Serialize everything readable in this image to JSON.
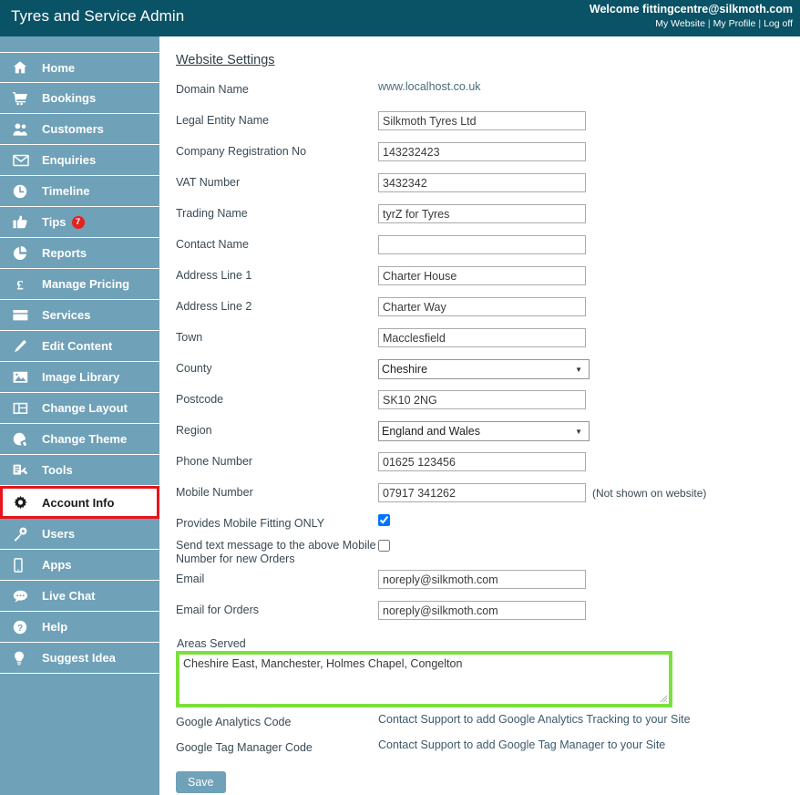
{
  "header": {
    "title": "Tyres and Service Admin",
    "welcome": "Welcome fittingcentre@silkmoth.com",
    "links": [
      {
        "label": "My Website"
      },
      {
        "label": "My Profile"
      },
      {
        "label": "Log off"
      }
    ],
    "separator": "|",
    "bg_color": "#0a5265"
  },
  "sidebar": {
    "bg_color": "#6fa1b8",
    "active_highlight_color": "#e8131a",
    "items": [
      {
        "label": "Home",
        "icon": "home-icon",
        "active": false
      },
      {
        "label": "Bookings",
        "icon": "cart-icon",
        "active": false
      },
      {
        "label": "Customers",
        "icon": "users-icon",
        "active": false
      },
      {
        "label": "Enquiries",
        "icon": "envelope-icon",
        "active": false
      },
      {
        "label": "Timeline",
        "icon": "clock-icon",
        "active": false
      },
      {
        "label": "Tips",
        "icon": "thumbs-up-icon",
        "active": false,
        "badge": "7"
      },
      {
        "label": "Reports",
        "icon": "pie-chart-icon",
        "active": false
      },
      {
        "label": "Manage Pricing",
        "icon": "pound-icon",
        "active": false
      },
      {
        "label": "Services",
        "icon": "card-icon",
        "active": false
      },
      {
        "label": "Edit Content",
        "icon": "pencil-icon",
        "active": false
      },
      {
        "label": "Image Library",
        "icon": "image-icon",
        "active": false
      },
      {
        "label": "Change Layout",
        "icon": "layout-icon",
        "active": false
      },
      {
        "label": "Change Theme",
        "icon": "paint-brush-icon",
        "active": false
      },
      {
        "label": "Tools",
        "icon": "tools-icon",
        "active": false
      },
      {
        "label": "Account Info",
        "icon": "gear-icon",
        "active": true
      },
      {
        "label": "Users",
        "icon": "key-icon",
        "active": false
      },
      {
        "label": "Apps",
        "icon": "mobile-icon",
        "active": false
      },
      {
        "label": "Live Chat",
        "icon": "chat-bubble-icon",
        "active": false
      },
      {
        "label": "Help",
        "icon": "question-mark-icon",
        "active": false
      },
      {
        "label": "Suggest Idea",
        "icon": "lightbulb-icon",
        "active": false
      }
    ]
  },
  "main": {
    "title": "Website Settings",
    "fields": {
      "domain_name": {
        "label": "Domain Name",
        "value": "www.localhost.co.uk",
        "type": "link"
      },
      "legal_entity_name": {
        "label": "Legal Entity Name",
        "value": "Silkmoth Tyres Ltd",
        "type": "text"
      },
      "company_registration_no": {
        "label": "Company Registration No",
        "value": "143232423",
        "type": "text"
      },
      "vat_number": {
        "label": "VAT Number",
        "value": "3432342",
        "type": "text"
      },
      "trading_name": {
        "label": "Trading Name",
        "value": "tyrZ for Tyres",
        "type": "text"
      },
      "contact_name": {
        "label": "Contact Name",
        "value": "",
        "type": "text"
      },
      "address_line_1": {
        "label": "Address Line 1",
        "value": "Charter House",
        "type": "text"
      },
      "address_line_2": {
        "label": "Address Line 2",
        "value": "Charter Way",
        "type": "text"
      },
      "town": {
        "label": "Town",
        "value": "Macclesfield",
        "type": "text"
      },
      "county": {
        "label": "County",
        "value": "Cheshire",
        "type": "select"
      },
      "postcode": {
        "label": "Postcode",
        "value": "SK10 2NG",
        "type": "text"
      },
      "region": {
        "label": "Region",
        "value": "England and Wales",
        "type": "select"
      },
      "phone_number": {
        "label": "Phone Number",
        "value": "01625 123456",
        "type": "text"
      },
      "mobile_number": {
        "label": "Mobile Number",
        "value": "07917 341262",
        "type": "text",
        "note": "(Not shown on website)"
      },
      "provides_mobile_fitting_only": {
        "label": "Provides Mobile Fitting ONLY",
        "checked": true,
        "type": "checkbox"
      },
      "send_text_message": {
        "label": "Send text message to the above Mobile Number for new Orders",
        "checked": false,
        "type": "checkbox"
      },
      "email": {
        "label": "Email",
        "value": "noreply@silkmoth.com",
        "type": "text"
      },
      "email_for_orders": {
        "label": "Email for Orders",
        "value": "noreply@silkmoth.com",
        "type": "text"
      },
      "areas_served": {
        "label": "Areas Served",
        "value": "Cheshire East, Manchester, Holmes Chapel, Congelton",
        "type": "textarea",
        "highlight_color": "#7CE03C"
      },
      "google_analytics_code": {
        "label": "Google Analytics Code",
        "value": "Contact Support to add Google Analytics Tracking to your Site",
        "type": "static"
      },
      "google_tag_manager_code": {
        "label": "Google Tag Manager Code",
        "value": "Contact Support to add Google Tag Manager to your Site",
        "type": "static"
      }
    },
    "save_label": "Save"
  }
}
